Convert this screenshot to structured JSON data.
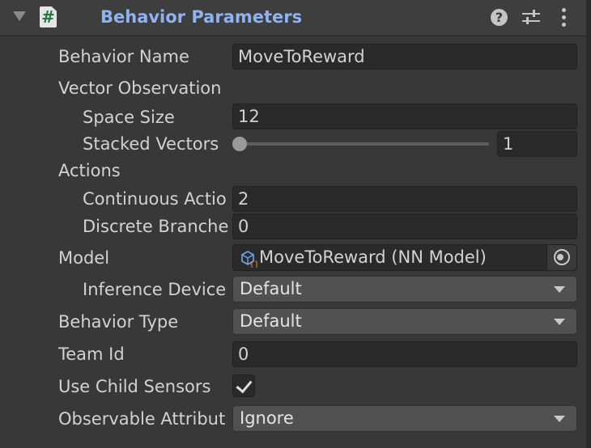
{
  "header": {
    "title": "Behavior Parameters",
    "script_glyph": "#",
    "icons": [
      "foldout-arrow-icon",
      "script-icon",
      "help-icon",
      "presets-icon",
      "more-options-icon"
    ]
  },
  "fields": {
    "behavior_name": {
      "label": "Behavior Name",
      "value": "MoveToReward"
    },
    "vector_observation": {
      "label": "Vector Observation"
    },
    "space_size": {
      "label": "Space Size",
      "value": "12"
    },
    "stacked_vectors": {
      "label": "Stacked Vectors",
      "value": "1",
      "slider_level": 0.0
    },
    "actions": {
      "label": "Actions"
    },
    "continuous_actions": {
      "label": "Continuous Actio",
      "value": "2"
    },
    "discrete_branches": {
      "label": "Discrete Branche",
      "value": "0"
    },
    "model": {
      "label": "Model",
      "value": "MoveToReward (NN Model)"
    },
    "inference_device": {
      "label": "Inference Device",
      "value": "Default"
    },
    "behavior_type": {
      "label": "Behavior Type",
      "value": "Default"
    },
    "team_id": {
      "label": "Team Id",
      "value": "0"
    },
    "use_child_sensors": {
      "label": "Use Child Sensors",
      "checked": true
    },
    "observable_attributes": {
      "label": "Observable Attribut",
      "value": "Ignore"
    }
  },
  "colors": {
    "panel_bg": "#383838",
    "header_bg": "#3e3e3e",
    "title": "#8fb3f2",
    "field_bg": "#2a2a2a",
    "dropdown_bg": "#515151",
    "text": "#d2d2d2"
  }
}
